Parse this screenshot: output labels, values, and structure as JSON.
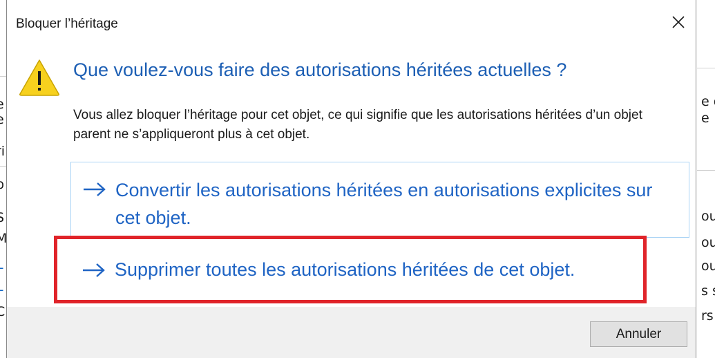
{
  "dialog": {
    "title": "Bloquer l’héritage",
    "heading": "Que voulez-vous faire des autorisations héritées actuelles ?",
    "description": "Vous allez bloquer l’héritage pour cet objet, ce qui signifie que les autorisations héritées d’un objet parent ne s’appliqueront plus à cet objet.",
    "options": [
      {
        "label": "Convertir les autorisations héritées en autorisations explicites sur cet objet.",
        "arrow_icon": "arrow-right-icon"
      },
      {
        "label": "Supprimer toutes les autorisations héritées de cet objet.",
        "arrow_icon": "arrow-right-icon"
      }
    ],
    "cancel_label": "Annuler",
    "icons": {
      "warning": "warning-icon",
      "close": "close-icon"
    }
  },
  "background_fragments": {
    "right": [
      "e d",
      "e",
      "ou",
      "ou",
      "ou",
      "s s",
      "rs"
    ],
    "left": [
      "e",
      "e",
      "ri",
      "p",
      "S",
      "M",
      "L",
      "L",
      "C"
    ]
  },
  "colors": {
    "heading": "#1d5fb4",
    "link": "#1f64c4",
    "highlight": "#e0242a",
    "footer": "#f0f0f0",
    "option_border": "#a9d3f5",
    "warning_fill": "#f7d11e"
  }
}
